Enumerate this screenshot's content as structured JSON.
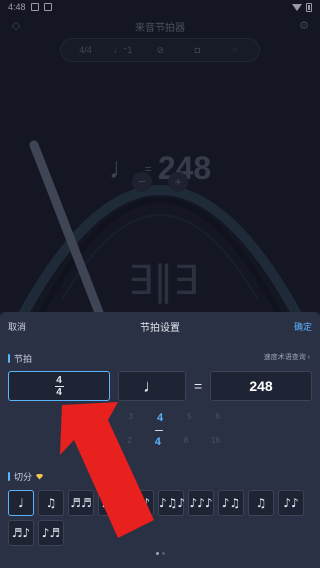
{
  "status_bar": {
    "time": "4:48"
  },
  "app": {
    "title": "来音节拍器",
    "toolbar": [
      {
        "name": "time-signature",
        "label": "4/4"
      },
      {
        "name": "beat-count",
        "label": "♩⁺1"
      },
      {
        "name": "mute",
        "label": "⊘"
      },
      {
        "name": "drum",
        "label": "◘"
      },
      {
        "name": "tap",
        "label": "☝"
      }
    ],
    "tempo": {
      "note": "♩",
      "eq": "=",
      "value": "248"
    },
    "minus": "−",
    "plus": "+",
    "beat_glyph": "∃‖∃"
  },
  "sheet": {
    "cancel": "取消",
    "title": "节拍设置",
    "confirm": "确定",
    "beat_section": "节拍",
    "lookup": "速度术语查询 ›",
    "meter": {
      "top": "4",
      "bottom": "4"
    },
    "note": "♩",
    "eq": "=",
    "bpm": "248",
    "picker_top": [
      "2",
      "3",
      "4",
      "5",
      "6"
    ],
    "picker_bottom": [
      "1",
      "2",
      "4",
      "8",
      "16"
    ],
    "subdivision_section": "切分",
    "subdivisions": [
      "♩",
      "♫",
      "♬♬",
      "♪♫",
      "♫♪",
      "♪♫♪",
      "♪♪♪",
      "♪♫",
      "♫",
      "♪♪",
      "♬♪",
      "♪♬"
    ]
  },
  "colors": {
    "accent": "#5bb4ff",
    "arrow": "#e8201e",
    "sheet_bg": "#2b3144"
  }
}
